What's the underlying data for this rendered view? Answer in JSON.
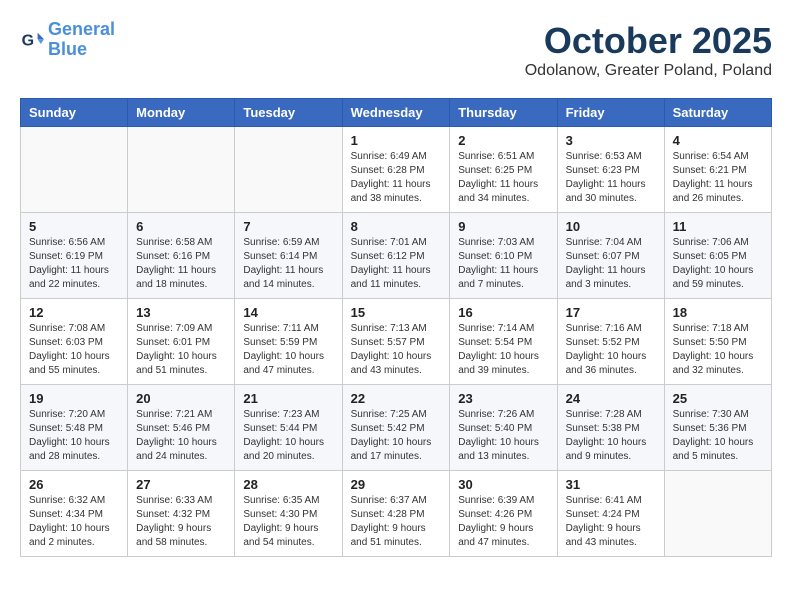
{
  "header": {
    "logo_line1": "General",
    "logo_line2": "Blue",
    "month_title": "October 2025",
    "location": "Odolanow, Greater Poland, Poland"
  },
  "weekdays": [
    "Sunday",
    "Monday",
    "Tuesday",
    "Wednesday",
    "Thursday",
    "Friday",
    "Saturday"
  ],
  "weeks": [
    [
      {
        "day": "",
        "info": ""
      },
      {
        "day": "",
        "info": ""
      },
      {
        "day": "",
        "info": ""
      },
      {
        "day": "1",
        "info": "Sunrise: 6:49 AM\nSunset: 6:28 PM\nDaylight: 11 hours\nand 38 minutes."
      },
      {
        "day": "2",
        "info": "Sunrise: 6:51 AM\nSunset: 6:25 PM\nDaylight: 11 hours\nand 34 minutes."
      },
      {
        "day": "3",
        "info": "Sunrise: 6:53 AM\nSunset: 6:23 PM\nDaylight: 11 hours\nand 30 minutes."
      },
      {
        "day": "4",
        "info": "Sunrise: 6:54 AM\nSunset: 6:21 PM\nDaylight: 11 hours\nand 26 minutes."
      }
    ],
    [
      {
        "day": "5",
        "info": "Sunrise: 6:56 AM\nSunset: 6:19 PM\nDaylight: 11 hours\nand 22 minutes."
      },
      {
        "day": "6",
        "info": "Sunrise: 6:58 AM\nSunset: 6:16 PM\nDaylight: 11 hours\nand 18 minutes."
      },
      {
        "day": "7",
        "info": "Sunrise: 6:59 AM\nSunset: 6:14 PM\nDaylight: 11 hours\nand 14 minutes."
      },
      {
        "day": "8",
        "info": "Sunrise: 7:01 AM\nSunset: 6:12 PM\nDaylight: 11 hours\nand 11 minutes."
      },
      {
        "day": "9",
        "info": "Sunrise: 7:03 AM\nSunset: 6:10 PM\nDaylight: 11 hours\nand 7 minutes."
      },
      {
        "day": "10",
        "info": "Sunrise: 7:04 AM\nSunset: 6:07 PM\nDaylight: 11 hours\nand 3 minutes."
      },
      {
        "day": "11",
        "info": "Sunrise: 7:06 AM\nSunset: 6:05 PM\nDaylight: 10 hours\nand 59 minutes."
      }
    ],
    [
      {
        "day": "12",
        "info": "Sunrise: 7:08 AM\nSunset: 6:03 PM\nDaylight: 10 hours\nand 55 minutes."
      },
      {
        "day": "13",
        "info": "Sunrise: 7:09 AM\nSunset: 6:01 PM\nDaylight: 10 hours\nand 51 minutes."
      },
      {
        "day": "14",
        "info": "Sunrise: 7:11 AM\nSunset: 5:59 PM\nDaylight: 10 hours\nand 47 minutes."
      },
      {
        "day": "15",
        "info": "Sunrise: 7:13 AM\nSunset: 5:57 PM\nDaylight: 10 hours\nand 43 minutes."
      },
      {
        "day": "16",
        "info": "Sunrise: 7:14 AM\nSunset: 5:54 PM\nDaylight: 10 hours\nand 39 minutes."
      },
      {
        "day": "17",
        "info": "Sunrise: 7:16 AM\nSunset: 5:52 PM\nDaylight: 10 hours\nand 36 minutes."
      },
      {
        "day": "18",
        "info": "Sunrise: 7:18 AM\nSunset: 5:50 PM\nDaylight: 10 hours\nand 32 minutes."
      }
    ],
    [
      {
        "day": "19",
        "info": "Sunrise: 7:20 AM\nSunset: 5:48 PM\nDaylight: 10 hours\nand 28 minutes."
      },
      {
        "day": "20",
        "info": "Sunrise: 7:21 AM\nSunset: 5:46 PM\nDaylight: 10 hours\nand 24 minutes."
      },
      {
        "day": "21",
        "info": "Sunrise: 7:23 AM\nSunset: 5:44 PM\nDaylight: 10 hours\nand 20 minutes."
      },
      {
        "day": "22",
        "info": "Sunrise: 7:25 AM\nSunset: 5:42 PM\nDaylight: 10 hours\nand 17 minutes."
      },
      {
        "day": "23",
        "info": "Sunrise: 7:26 AM\nSunset: 5:40 PM\nDaylight: 10 hours\nand 13 minutes."
      },
      {
        "day": "24",
        "info": "Sunrise: 7:28 AM\nSunset: 5:38 PM\nDaylight: 10 hours\nand 9 minutes."
      },
      {
        "day": "25",
        "info": "Sunrise: 7:30 AM\nSunset: 5:36 PM\nDaylight: 10 hours\nand 5 minutes."
      }
    ],
    [
      {
        "day": "26",
        "info": "Sunrise: 6:32 AM\nSunset: 4:34 PM\nDaylight: 10 hours\nand 2 minutes."
      },
      {
        "day": "27",
        "info": "Sunrise: 6:33 AM\nSunset: 4:32 PM\nDaylight: 9 hours\nand 58 minutes."
      },
      {
        "day": "28",
        "info": "Sunrise: 6:35 AM\nSunset: 4:30 PM\nDaylight: 9 hours\nand 54 minutes."
      },
      {
        "day": "29",
        "info": "Sunrise: 6:37 AM\nSunset: 4:28 PM\nDaylight: 9 hours\nand 51 minutes."
      },
      {
        "day": "30",
        "info": "Sunrise: 6:39 AM\nSunset: 4:26 PM\nDaylight: 9 hours\nand 47 minutes."
      },
      {
        "day": "31",
        "info": "Sunrise: 6:41 AM\nSunset: 4:24 PM\nDaylight: 9 hours\nand 43 minutes."
      },
      {
        "day": "",
        "info": ""
      }
    ]
  ]
}
